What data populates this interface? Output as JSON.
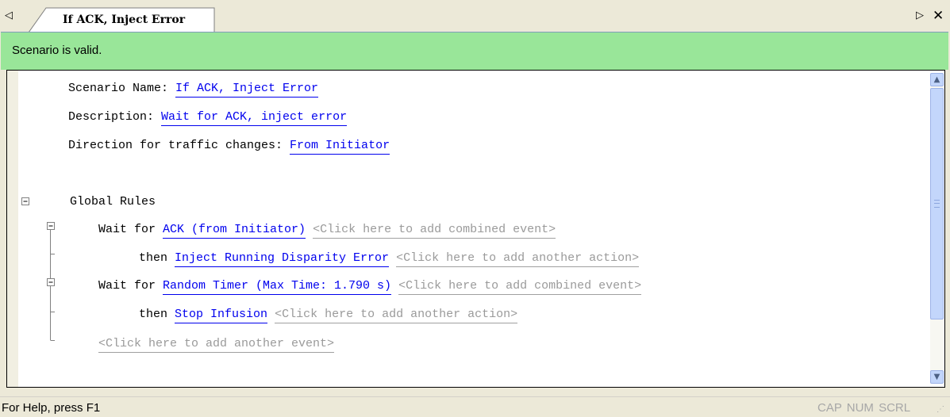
{
  "tab": {
    "title": "If ACK, Inject Error",
    "scroll_left_icon": "◁",
    "scroll_right_icon": "▷",
    "close_icon": "✕"
  },
  "banner": {
    "text": "Scenario is valid.",
    "color": "#99e699"
  },
  "properties": {
    "name_label": "Scenario Name: ",
    "name_value": "If ACK, Inject Error",
    "description_label": "Description: ",
    "description_value": "Wait for ACK, inject error",
    "direction_label": "Direction for traffic changes: ",
    "direction_value": "From Initiator"
  },
  "rules": {
    "global_label": "Global Rules",
    "wait1_prefix": "Wait for ",
    "wait1_value": "ACK (from Initiator)",
    "wait1_hint": "<Click here to add combined event>",
    "then1_prefix": "then ",
    "then1_value": "Inject Running Disparity Error",
    "then1_hint": "<Click here to add another action>",
    "wait2_prefix": "Wait for ",
    "wait2_value": "Random Timer (Max Time: 1.790 s)",
    "wait2_hint": "<Click here to add combined event>",
    "then2_prefix": "then ",
    "then2_value": "Stop Infusion",
    "then2_hint": "<Click here to add another action>",
    "add_event_hint": "<Click here to add another event>"
  },
  "statusbar": {
    "help_text": "For Help, press F1",
    "indicators": "CAP  NUM  SCRL"
  },
  "colors": {
    "link": "#0000ee",
    "hint": "#9a9a9a",
    "scroll_thumb": "#c3d6fb"
  }
}
